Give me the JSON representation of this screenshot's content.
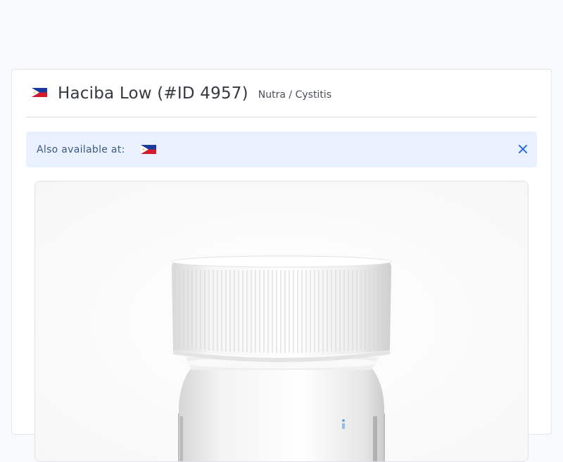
{
  "product": {
    "name": "Haciba Low (#ID 4957)",
    "category": "Nutra / Cystitis",
    "country_flag_icon": "philippines-flag-icon"
  },
  "availability": {
    "label": "Also available at:",
    "flags": [
      "philippines-flag-icon"
    ],
    "close_icon": "close-icon"
  },
  "colors": {
    "alert_background": "#e9f0fe",
    "alert_text": "#3d5a80",
    "close_icon": "#2f6fd6"
  }
}
